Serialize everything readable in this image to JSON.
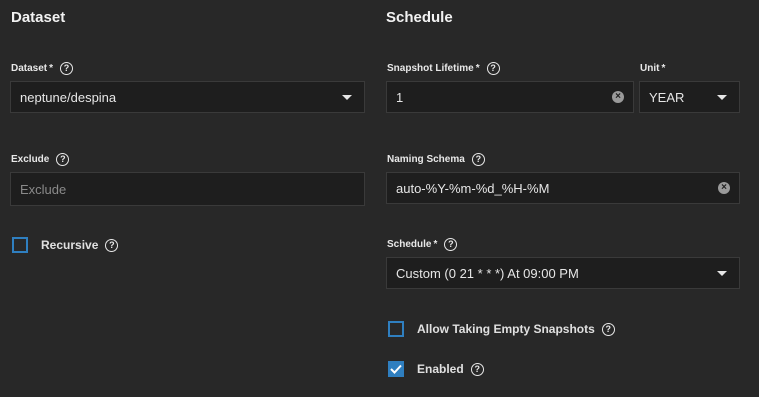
{
  "dataset_section": {
    "title": "Dataset",
    "dataset": {
      "label": "Dataset",
      "required_mark": "*",
      "value": "neptune/despina"
    },
    "exclude": {
      "label": "Exclude",
      "value": "",
      "placeholder": "Exclude"
    },
    "recursive": {
      "label": "Recursive",
      "checked": false
    }
  },
  "schedule_section": {
    "title": "Schedule",
    "snapshot_lifetime": {
      "label": "Snapshot Lifetime",
      "required_mark": "*",
      "value": "1"
    },
    "unit": {
      "label": "Unit",
      "required_mark": "*",
      "value": "YEAR"
    },
    "naming_schema": {
      "label": "Naming Schema",
      "value": "auto-%Y-%m-%d_%H-%M"
    },
    "schedule": {
      "label": "Schedule",
      "required_mark": "*",
      "value": "Custom (0 21 * * *) At 09:00 PM"
    },
    "allow_empty": {
      "label": "Allow Taking Empty Snapshots",
      "checked": false
    },
    "enabled": {
      "label": "Enabled",
      "checked": true
    }
  },
  "icons": {
    "help": "?",
    "clear": "×"
  },
  "colors": {
    "background": "#282828",
    "field_background": "#1e1e1e",
    "accent": "#2f7fc0"
  }
}
